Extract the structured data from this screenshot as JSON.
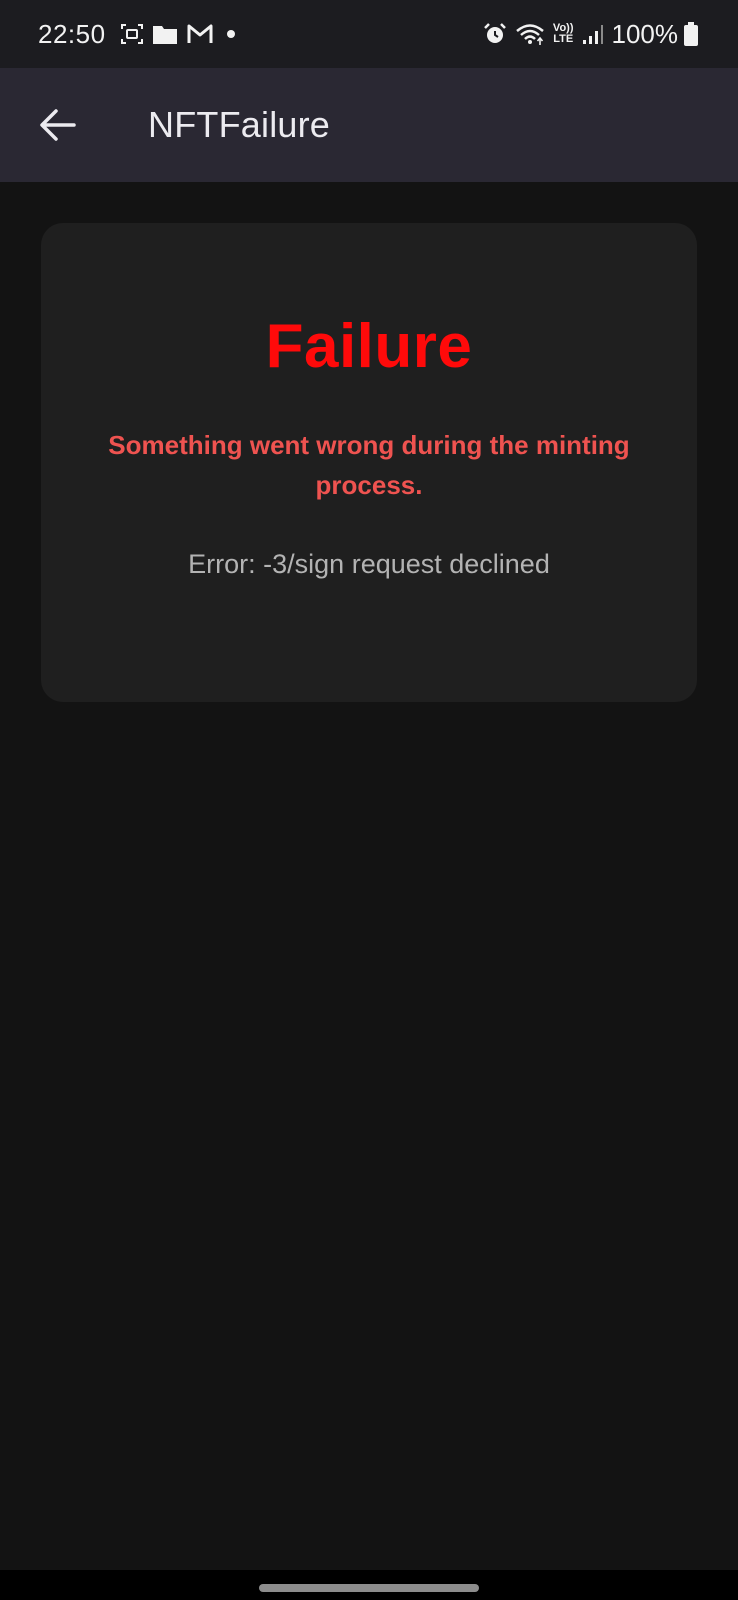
{
  "status_bar": {
    "time": "22:50",
    "battery_percent": "100%",
    "icons_left": [
      "screenshot-icon",
      "folder-icon",
      "gmail-icon",
      "dot-icon"
    ],
    "icons_right": [
      "alarm-icon",
      "wifi-icon",
      "volte-icon",
      "signal-icon",
      "battery-icon"
    ],
    "volte_label_top": "Vo))",
    "volte_label_bottom": "LTE"
  },
  "app_bar": {
    "title": "NFTFailure",
    "back_icon": "arrow-back-icon"
  },
  "card": {
    "title": "Failure",
    "message": "Something went wrong during the minting process.",
    "error": "Error: -3/sign request declined"
  },
  "colors": {
    "background": "#131313",
    "app_bar": "#2a2833",
    "card": "#1f1f1f",
    "title_red": "#ff0a0a",
    "message_red": "#ef5350",
    "error_gray": "#b3b3b3"
  }
}
